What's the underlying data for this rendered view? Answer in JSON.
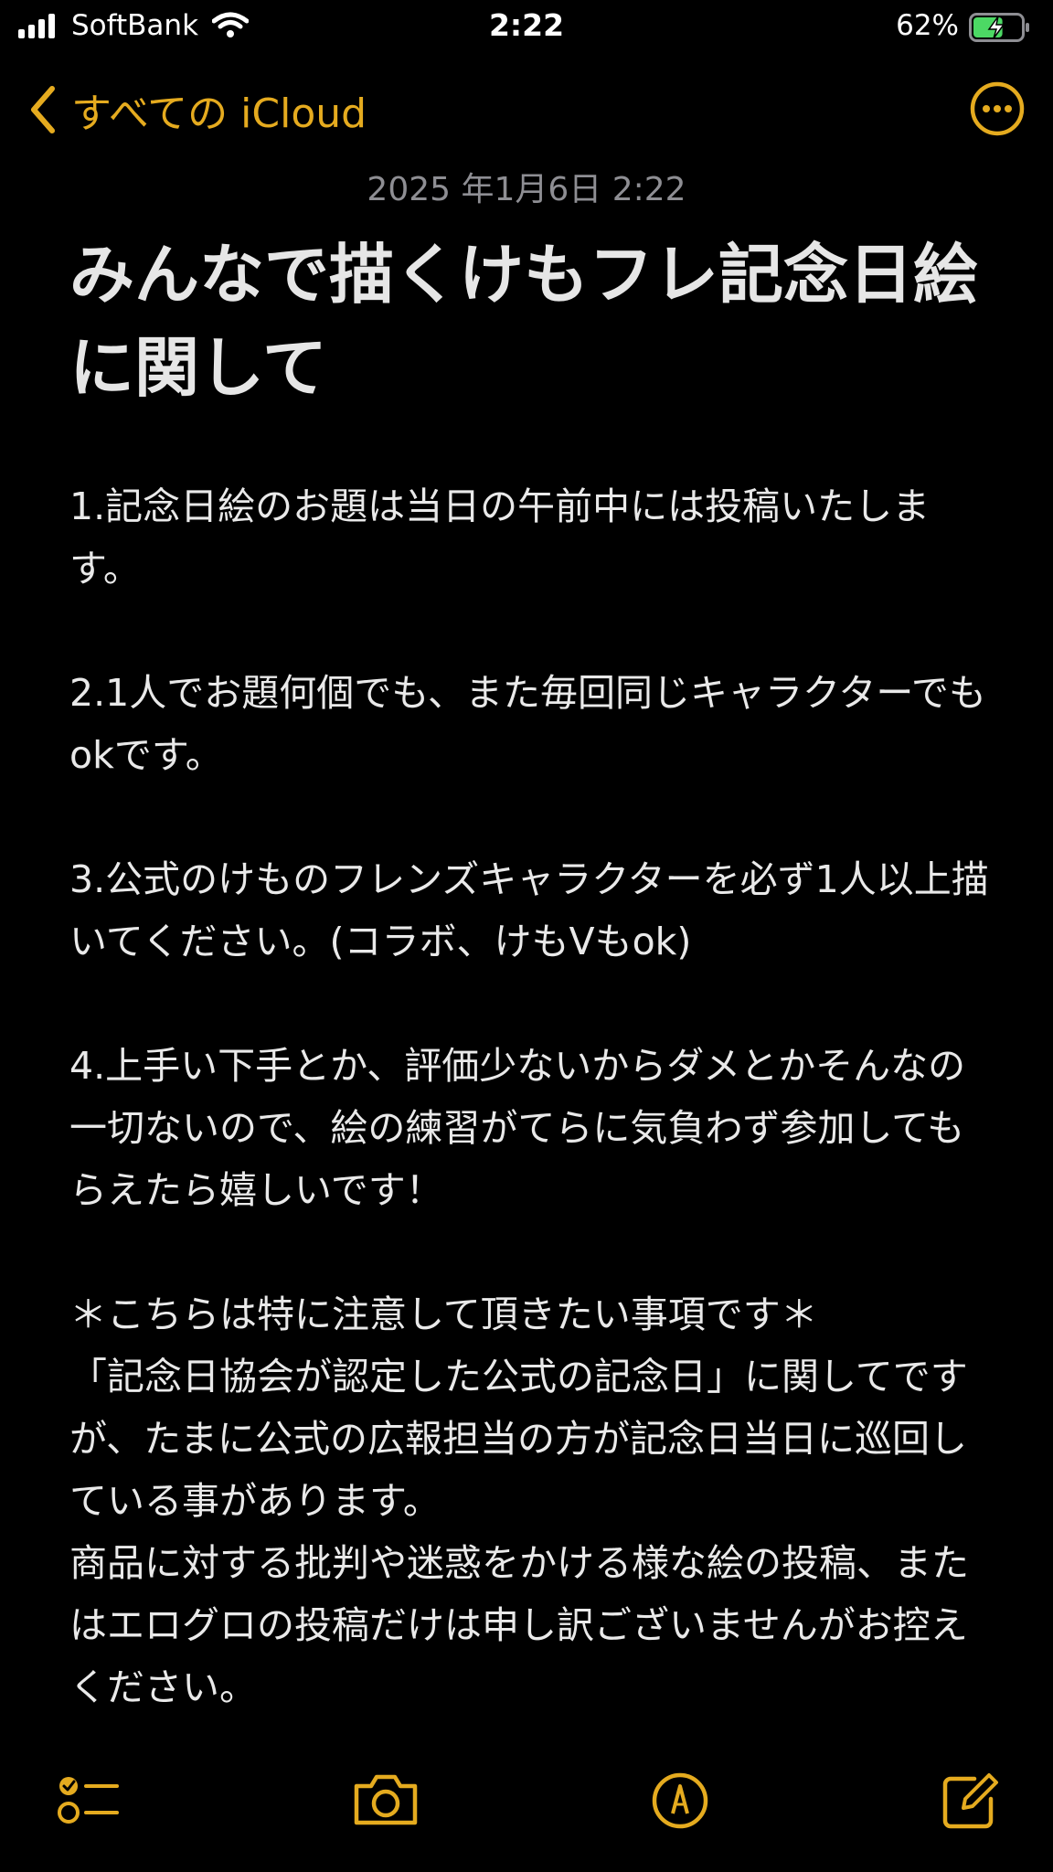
{
  "status_bar": {
    "carrier": "SoftBank",
    "time": "2:22",
    "battery_percent": "62%",
    "battery_level": 0.62,
    "charging": true
  },
  "nav": {
    "back_label": "すべての iCloud",
    "more_icon": "ellipsis-circle-icon"
  },
  "note": {
    "date": "2025 年1月6日 2:22",
    "title": "みんなで描くけもフレ記念日絵に関して",
    "paragraphs": [
      "1.記念日絵のお題は当日の午前中には投稿いたします。",
      "2.1人でお題何個でも、また毎回同じキャラクターでもokです。",
      "3.公式のけものフレンズキャラクターを必ず1人以上描いてください。(コラボ、けもVもok)",
      "4.上手い下手とか、評価少ないからダメとかそんなの一切ないので、絵の練習がてらに気負わず参加してもらえたら嬉しいです！"
    ],
    "notice": {
      "heading": "＊こちらは特に注意して頂きたい事項です＊",
      "line1": "「記念日協会が認定した公式の記念日」に関してですが、たまに公式の広報担当の方が記念日当日に巡回している事があります。",
      "line2": "商品に対する批判や迷惑をかける様な絵の投稿、またはエログロの投稿だけは申し訳ございませんがお控えください。"
    }
  },
  "toolbar": {
    "icons": [
      "checklist-icon",
      "camera-icon",
      "markup-pen-icon",
      "compose-icon"
    ]
  },
  "colors": {
    "accent": "#e5ab1f",
    "background": "#000000",
    "battery_fill": "#4cd964"
  }
}
